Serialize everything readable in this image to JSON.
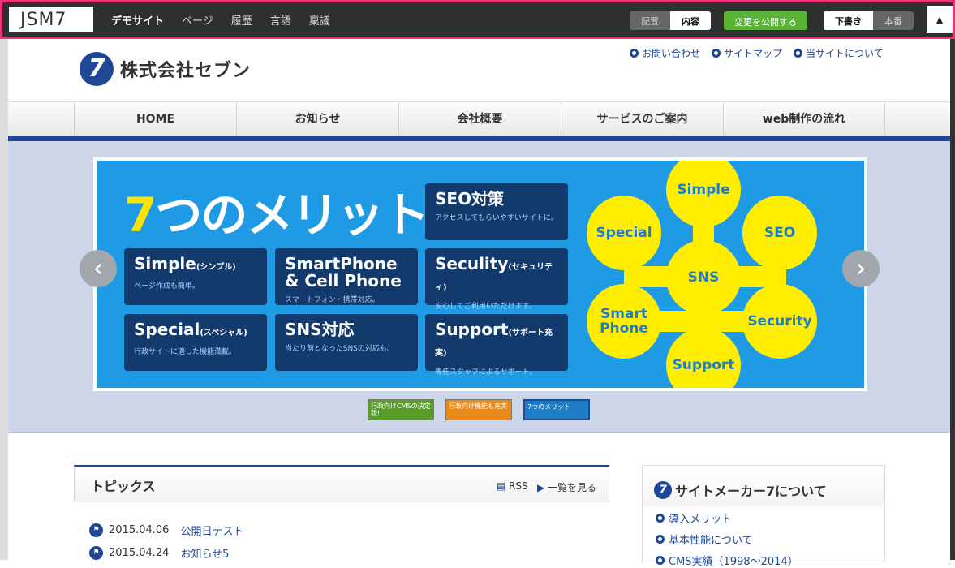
{
  "admin": {
    "brand": "JSM7",
    "menu": [
      "デモサイト",
      "ページ",
      "履歴",
      "言語",
      "稟議"
    ],
    "view_mode": {
      "layout": "配置",
      "content": "内容"
    },
    "publish": "変更を公開する",
    "draft_mode": {
      "draft": "下書き",
      "live": "本番"
    },
    "collapse_icon": "▲"
  },
  "site": {
    "logo_mark": "7",
    "company_name": "株式会社セブン",
    "util_links": [
      "お問い合わせ",
      "サイトマップ",
      "当サイトについて"
    ],
    "nav": [
      "HOME",
      "お知らせ",
      "会社概要",
      "サービスのご案内",
      "web制作の流れ"
    ]
  },
  "slider": {
    "title_num": "7",
    "title_rest": "つのメリット",
    "cards": [
      {
        "title": "SEO対策",
        "sub": "",
        "desc": "アクセスしてもらいやすいサイトに。"
      },
      {
        "title": "Simple",
        "sub": "(シンプル)",
        "desc": "ページ作成も簡単。"
      },
      {
        "title": "SmartPhone & Cell Phone",
        "sub": "",
        "desc": "スマートフォン・携帯対応。"
      },
      {
        "title": "Seculity",
        "sub": "(セキュリティ)",
        "desc": "安心してご利用いただけます。"
      },
      {
        "title": "Special",
        "sub": "(スペシャル)",
        "desc": "行政サイトに適した機能満載。"
      },
      {
        "title": "SNS対応",
        "sub": "",
        "desc": "当たり前となったSNSの対応も。"
      },
      {
        "title": "Support",
        "sub": "(サポート充実)",
        "desc": "専任スタッフによるサポート。"
      }
    ],
    "bubbles": [
      "Simple",
      "Special",
      "SEO",
      "SNS",
      "Smart Phone",
      "Security",
      "Support"
    ],
    "prev_icon": "‹",
    "next_icon": "›",
    "thumbs": [
      "行政向けCMSの決定版!",
      "行政向け機能も充実",
      "7つのメリット"
    ]
  },
  "topics": {
    "title": "トピックス",
    "rss": "RSS",
    "more": "一覧を見る",
    "items": [
      {
        "date": "2015.04.06",
        "title": "公開日テスト"
      },
      {
        "date": "2015.04.24",
        "title": "お知らせ5"
      }
    ]
  },
  "sidebar": {
    "mark": "7",
    "title": "サイトメーカー7について",
    "links": [
      "導入メリット",
      "基本性能について",
      "CMS実績（1998〜2014）"
    ]
  }
}
